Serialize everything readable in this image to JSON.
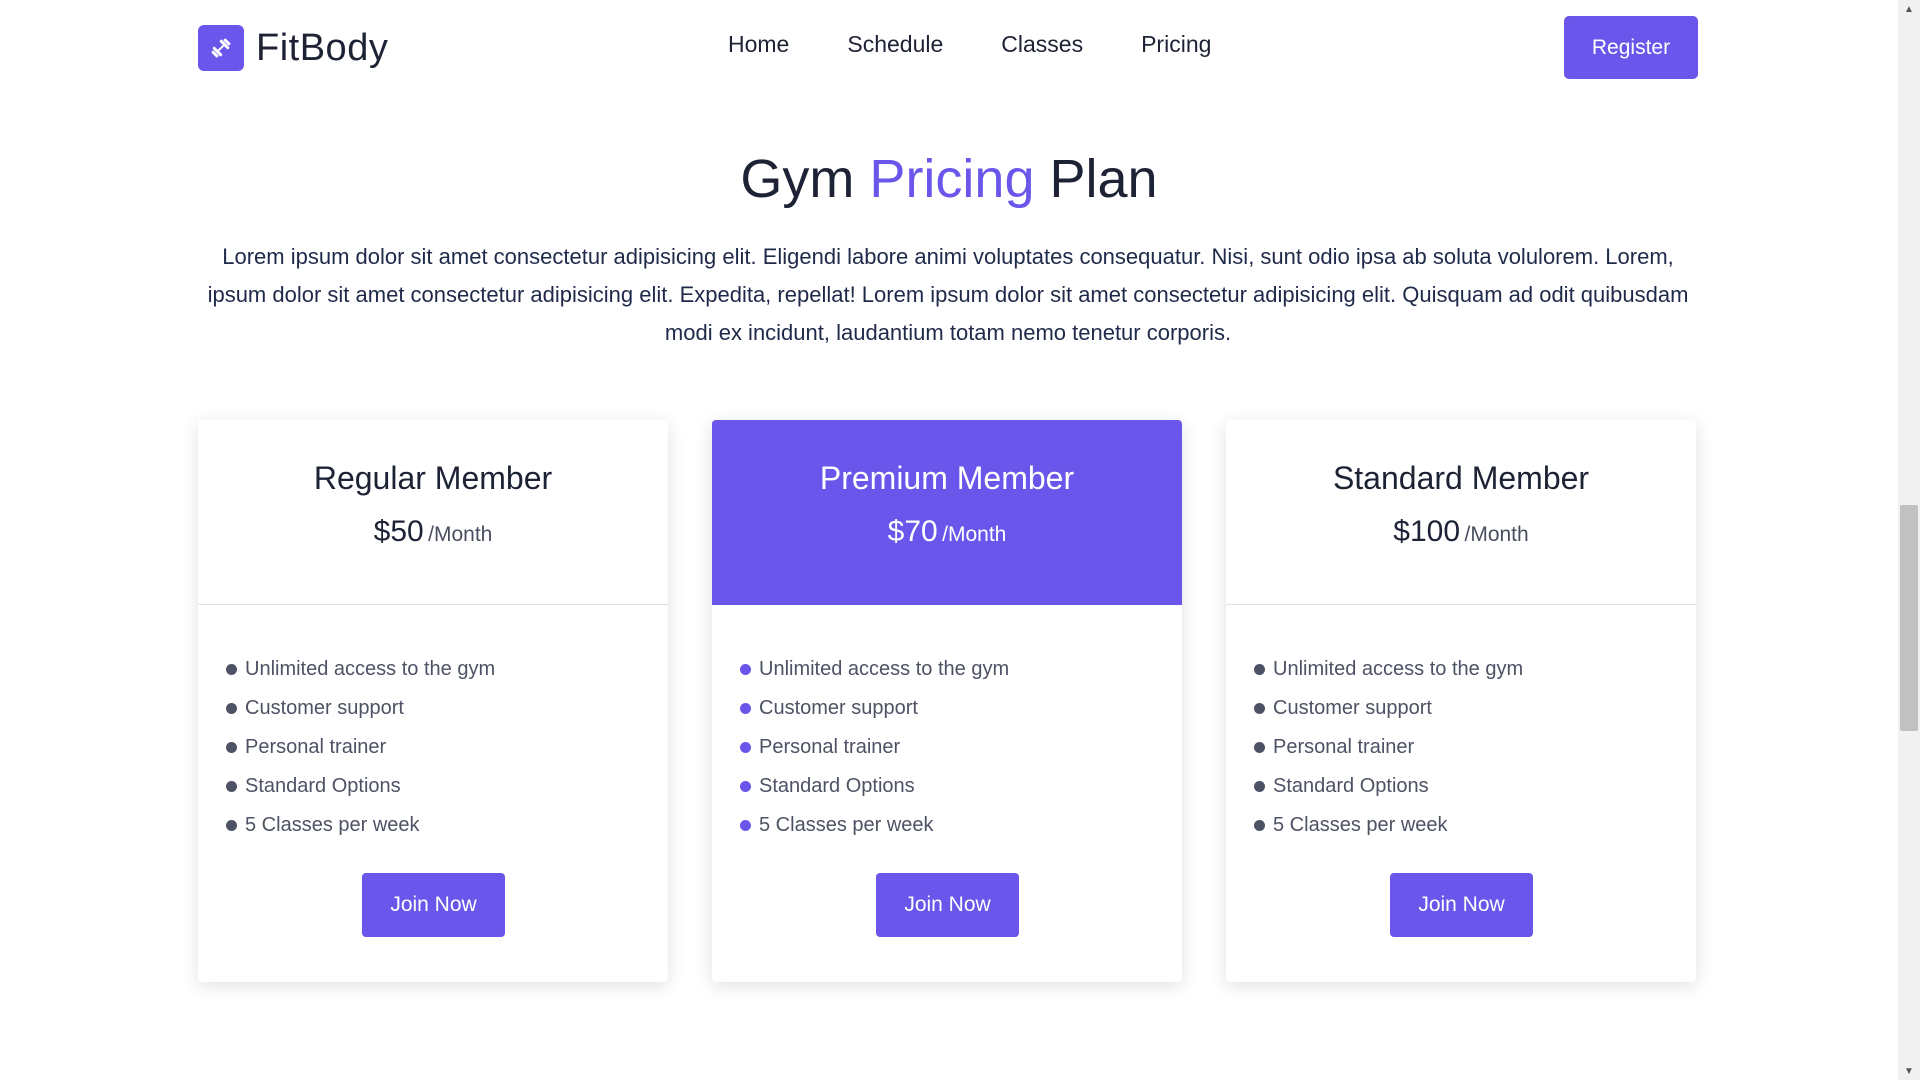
{
  "header": {
    "brand": "FitBody",
    "logo_icon": "dumbbell-icon",
    "nav": [
      "Home",
      "Schedule",
      "Classes",
      "Pricing"
    ],
    "register_label": "Register"
  },
  "section": {
    "title_part1": "Gym",
    "title_accent": "Pricing",
    "title_part2": "Plan",
    "description": "Lorem ipsum dolor sit amet consectetur adipisicing elit. Eligendi labore animi voluptates consequatur. Nisi, sunt odio ipsa ab soluta volulorem. Lorem, ipsum dolor sit amet consectetur adipisicing elit. Expedita, repellat! Lorem ipsum dolor sit amet consectetur adipisicing elit. Quisquam ad odit quibusdam modi ex incidunt, laudantium totam nemo tenetur corporis."
  },
  "plans": [
    {
      "name": "Regular Member",
      "price": "$50",
      "period": "/Month",
      "features": [
        "Unlimited access to the gym",
        "Customer support",
        "Personal trainer",
        "Standard Options",
        "5 Classes per week"
      ],
      "cta": "Join Now"
    },
    {
      "name": "Premium Member",
      "price": "$70",
      "period": "/Month",
      "features": [
        "Unlimited access to the gym",
        "Customer support",
        "Personal trainer",
        "Standard Options",
        "5 Classes per week"
      ],
      "cta": "Join Now"
    },
    {
      "name": "Standard Member",
      "price": "$100",
      "period": "/Month",
      "features": [
        "Unlimited access to the gym",
        "Customer support",
        "Personal trainer",
        "Standard Options",
        "5 Classes per week"
      ],
      "cta": "Join Now"
    }
  ],
  "colors": {
    "accent": "#6a56ea",
    "heading": "#1d2235",
    "body_text": "#4d5264"
  }
}
